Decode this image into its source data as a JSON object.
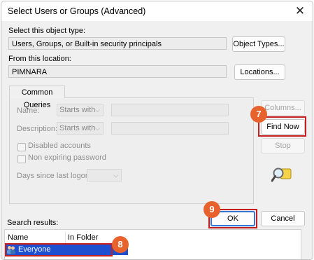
{
  "window": {
    "title": "Select Users or Groups (Advanced)",
    "close_glyph": "✕"
  },
  "object_type": {
    "label": "Select this object type:",
    "value": "Users, Groups, or Built-in security principals",
    "button": "Object Types..."
  },
  "location": {
    "label": "From this location:",
    "value": "PIMNARA",
    "button": "Locations..."
  },
  "common_queries": {
    "tab": "Common Queries",
    "name": {
      "label": "Name:",
      "combo": "Starts with"
    },
    "description": {
      "label": "Description:",
      "combo": "Starts with"
    },
    "disabled_accounts": "Disabled accounts",
    "non_expiring_password": "Non expiring password",
    "days_since_last_logon": "Days since last logon:"
  },
  "buttons": {
    "columns": "Columns...",
    "find_now": "Find Now",
    "stop": "Stop",
    "ok": "OK",
    "cancel": "Cancel"
  },
  "results": {
    "label": "Search results:",
    "columns": [
      "Name",
      "In Folder"
    ],
    "rows": [
      {
        "name": "Everyone",
        "folder": ""
      }
    ]
  },
  "callouts": {
    "find_now": "7",
    "results_row": "8",
    "ok": "9"
  },
  "colors": {
    "highlight": "#c41e1e",
    "badge": "#e8622e",
    "selection": "#1d4fd0",
    "primary_border": "#3478d4"
  },
  "icons": {
    "search": "magnifier-icon",
    "user_group": "user-group-icon",
    "close": "close-icon",
    "dropdown": "chevron-down-icon"
  }
}
